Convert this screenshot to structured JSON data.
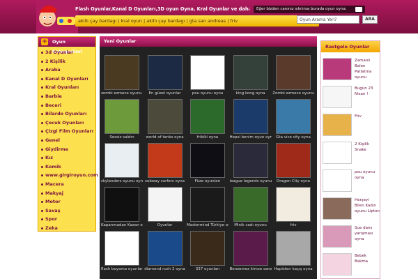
{
  "header": {
    "title": "Flash Oyunlar,Kanal D Oyunları,3D oyun Oyna, Kral Oyunlar ve dahası fisekoyun.Com'da",
    "links": "akillı çay bardagı | kral oyun | akillı çay bardagı | gta san andreas | friv",
    "notice": "Eğer bizden canınız sıkılırsa burada oyun oyna.",
    "search_placeholder": "Oyun Arama Yeri?",
    "search_button": "ARA"
  },
  "left": {
    "title": "Oyun Kategorileri",
    "items": [
      "3d Oyunlar",
      "2 Kişilik",
      "Araba",
      "Kanal D Oyunları",
      "Kral Oyunları",
      "Barbie",
      "Beceri",
      "Bilardo Oyunları",
      "Çocuk Oyunları",
      "Çizgi Film Oyunları",
      "Genel",
      "Giydirme",
      "Kız",
      "Komik",
      "www.girgiroyun.com",
      "Macera",
      "Makyaj",
      "Motor",
      "Savaş",
      "Spor",
      "Zeka"
    ]
  },
  "main": {
    "title": "Yeni Oyunlar",
    "games": [
      {
        "label": "zombi ezmece oyunu oyna",
        "color": "#4a3a22"
      },
      {
        "label": "En güzel oyunlar",
        "color": "#1c2a44"
      },
      {
        "label": "pou oyunu oyna",
        "color": "#ffffff"
      },
      {
        "label": "king kong oyna",
        "color": "#33413a"
      },
      {
        "label": "Zombi ezmece oyunu",
        "color": "#5a3a2a"
      },
      {
        "label": "Sessiz saldırı",
        "color": "#6d9a3a"
      },
      {
        "label": "world of tanks oyna",
        "color": "#4c4a3a"
      },
      {
        "label": "frikiki oyna",
        "color": "#2c6a2c"
      },
      {
        "label": "Hepsi benim oyun oyna oyna",
        "color": "#1b3b6a"
      },
      {
        "label": "Gta vice city oyna",
        "color": "#3a7aa8"
      },
      {
        "label": "skylanders oyunu oyna",
        "color": "#e8eef2"
      },
      {
        "label": "subway surfers oyna",
        "color": "#c23a1a"
      },
      {
        "label": "Füze oyunları",
        "color": "#0e0e14"
      },
      {
        "label": "league legends oyunu oyna kanal",
        "color": "#2b2a3a"
      },
      {
        "label": "Dragon City oyna",
        "color": "#a02a1a"
      },
      {
        "label": "Kapanmadan Kazan oyunu oyna",
        "color": "#101010"
      },
      {
        "label": "Oyunlar",
        "color": "#f4f4f4"
      },
      {
        "label": "Mastermind Türkiye oyna",
        "color": "#1a1a1a"
      },
      {
        "label": "Minik cadı oyunu",
        "color": "#3a6a2a"
      },
      {
        "label": "friv",
        "color": "#f2ece0"
      },
      {
        "label": "flash boyama oyunları",
        "color": "#ffffff"
      },
      {
        "label": "diamond rush 2 oyna",
        "color": "#1a4a8a"
      },
      {
        "label": "337 oyunları",
        "color": "#3a2a1a"
      },
      {
        "label": "Benzemez kimse sana oyna",
        "color": "#5a1a4a"
      },
      {
        "label": "Hapisten kaçış oyna",
        "color": "#a8a8a8"
      }
    ]
  },
  "right": {
    "title": "Rastgele Oyunlar",
    "items": [
      {
        "label": "Zamanlı Balon Patlatma oyunu",
        "color": "#b83a7a"
      },
      {
        "label": "Bugün 23 Nisan !",
        "color": "#f6f6f6"
      },
      {
        "label": "Friv",
        "color": "#e8b24a"
      },
      {
        "label": "2 Kişilik Snake",
        "color": "#ffffff"
      },
      {
        "label": "pou oyunu oyna",
        "color": "#ffffff"
      },
      {
        "label": "Herşeyi Bilen Kadın oyunu Lipton",
        "color": "#8a6a5a"
      },
      {
        "label": "Sue dans yarışması oyna",
        "color": "#d89ab8"
      },
      {
        "label": "Bebek Bakma",
        "color": "#f4d4e0"
      }
    ]
  }
}
